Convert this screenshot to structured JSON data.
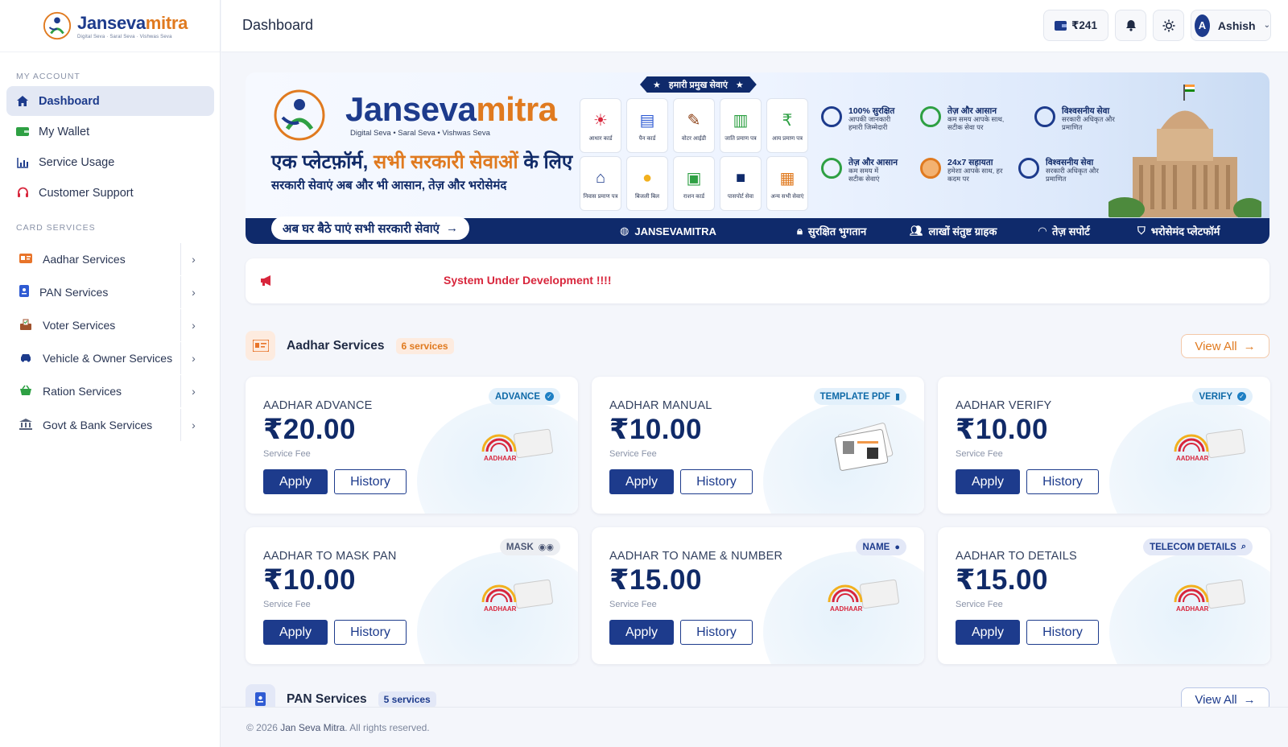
{
  "brand": {
    "name_a": "Janseva",
    "name_b": "mitra",
    "tagline": "Digital Seva · Saral Seva · Vishwas Seva"
  },
  "sidebar": {
    "section_account": "MY ACCOUNT",
    "account_items": [
      {
        "label": "Dashboard",
        "icon": "home-icon"
      },
      {
        "label": "My Wallet",
        "icon": "wallet-icon"
      },
      {
        "label": "Service Usage",
        "icon": "chart-icon"
      },
      {
        "label": "Customer Support",
        "icon": "headset-icon"
      }
    ],
    "section_services": "CARD SERVICES",
    "service_items": [
      {
        "label": "Aadhar Services"
      },
      {
        "label": "PAN Services"
      },
      {
        "label": "Voter Services"
      },
      {
        "label": "Vehicle & Owner Services"
      },
      {
        "label": "Ration Services"
      },
      {
        "label": "Govt & Bank Services"
      }
    ]
  },
  "header": {
    "title": "Dashboard",
    "wallet_balance": "₹241",
    "user_initial": "A",
    "user_name": "Ashish"
  },
  "banner": {
    "brand_a": "Janseva",
    "brand_b": "mitra",
    "tagline": "Digital Seva  •  Saral Seva  •  Vishwas Seva",
    "headline_a": "एक प्लेटफ़ॉर्म, ",
    "headline_b": "सभी सरकारी सेवाओं",
    "headline_c": " के लिए",
    "subline": "सरकारी सेवाएं अब और भी आसान, तेज़ और भरोसेमंद",
    "cta": "अब घर बैठे पाएं सभी सरकारी सेवाएं",
    "pill": "हमारी प्रमुख सेवाएं",
    "tiles": [
      "आधार कार्ड",
      "पैन कार्ड",
      "वोटर आईडी",
      "जाति प्रमाण पत्र",
      "आय प्रमाण पत्र",
      "निवास प्रमाण पत्र",
      "बिजली बिल",
      "राशन कार्ड",
      "पासपोर्ट सेवा",
      "अन्य सभी सेवाएं"
    ],
    "features": [
      {
        "title": "100% सुरक्षित",
        "sub": "आपकी जानकारी हमारी जिम्मेदारी"
      },
      {
        "title": "तेज़ और आसान",
        "sub": "कम समय आपके साथ, सटीक सेवा पर"
      },
      {
        "title": "विश्वसनीय सेवा",
        "sub": "सरकारी अधिकृत और प्रमाणित"
      },
      {
        "title": "तेज़ और आसान",
        "sub": "कम समय में सटीक सेवाएं"
      },
      {
        "title": "24x7 सहायता",
        "sub": "हमेशा आपके साथ, हर कदम पर"
      },
      {
        "title": "विश्वसनीय सेवा",
        "sub": "सरकारी अधिकृत और प्रमाणित"
      }
    ],
    "bottom": [
      "JANSEVAMITRA",
      "सुरक्षित भुगतान",
      "लाखों संतुष्ट ग्राहक",
      "तेज़ सपोर्ट",
      "भरोसेमंद प्लेटफॉर्म"
    ]
  },
  "notice": {
    "text": "System Under Development !!!!"
  },
  "aadhar_section": {
    "title": "Aadhar Services",
    "badge": "6 services",
    "view_all": "View All",
    "cards": [
      {
        "title": "AADHAR ADVANCE",
        "price": "₹20.00",
        "fee": "Service Fee",
        "badge": "ADVANCE",
        "apply": "Apply",
        "history": "History"
      },
      {
        "title": "AADHAR MANUAL",
        "price": "₹10.00",
        "fee": "Service Fee",
        "badge": "TEMPLATE PDF",
        "apply": "Apply",
        "history": "History"
      },
      {
        "title": "AADHAR VERIFY",
        "price": "₹10.00",
        "fee": "Service Fee",
        "badge": "VERIFY",
        "apply": "Apply",
        "history": "History"
      },
      {
        "title": "AADHAR TO MASK PAN",
        "price": "₹10.00",
        "fee": "Service Fee",
        "badge": "MASK",
        "apply": "Apply",
        "history": "History"
      },
      {
        "title": "AADHAR TO NAME & NUMBER",
        "price": "₹15.00",
        "fee": "Service Fee",
        "badge": "NAME",
        "apply": "Apply",
        "history": "History"
      },
      {
        "title": "AADHAR TO DETAILS",
        "price": "₹15.00",
        "fee": "Service Fee",
        "badge": "TELECOM DETAILS",
        "apply": "Apply",
        "history": "History"
      }
    ]
  },
  "pan_section": {
    "title": "PAN Services",
    "badge": "5 services",
    "view_all": "View All"
  },
  "footer": {
    "prefix": "© 2026 ",
    "name": "Jan Seva Mitra",
    "suffix": ". All rights reserved."
  },
  "colors": {
    "primary": "#1d3b8c",
    "accent": "#e07a1f",
    "alert": "#d8263c"
  }
}
